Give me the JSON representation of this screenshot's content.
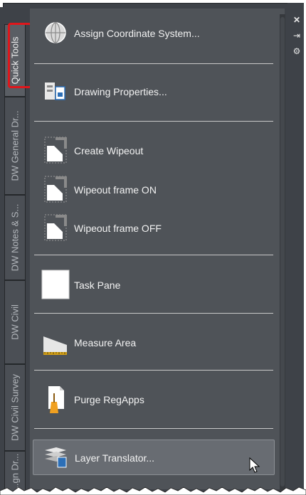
{
  "tabs": [
    {
      "label": "Quick Tools",
      "active": true
    },
    {
      "label": "DW General Dr...",
      "active": false
    },
    {
      "label": "DW Notes & S...",
      "active": false
    },
    {
      "label": "DW Civil",
      "active": false
    },
    {
      "label": "DW Civil Survey",
      "active": false
    },
    {
      "label": "...gn Dr...",
      "active": false
    }
  ],
  "side_controls": {
    "close": "✕",
    "autohide": "⇥",
    "settings": "⚙"
  },
  "items": [
    {
      "label": "Assign Coordinate System...",
      "icon": "globe-icon"
    },
    {
      "label": "Drawing Properties...",
      "icon": "drawing-properties-icon"
    },
    {
      "label": "Create Wipeout",
      "icon": "wipeout-icon"
    },
    {
      "label": "Wipeout frame ON",
      "icon": "wipeout-frame-on-icon"
    },
    {
      "label": "Wipeout frame OFF",
      "icon": "wipeout-frame-off-icon"
    },
    {
      "label": "Task Pane",
      "icon": "task-pane-icon"
    },
    {
      "label": "Measure Area",
      "icon": "measure-area-icon"
    },
    {
      "label": "Purge RegApps",
      "icon": "purge-regapps-icon"
    },
    {
      "label": "Layer Translator...",
      "icon": "layer-translator-icon",
      "hover": true
    }
  ],
  "colors": {
    "panel": "#4f5358",
    "tab_highlight": "#e0161b",
    "text": "#f2f2f2"
  }
}
